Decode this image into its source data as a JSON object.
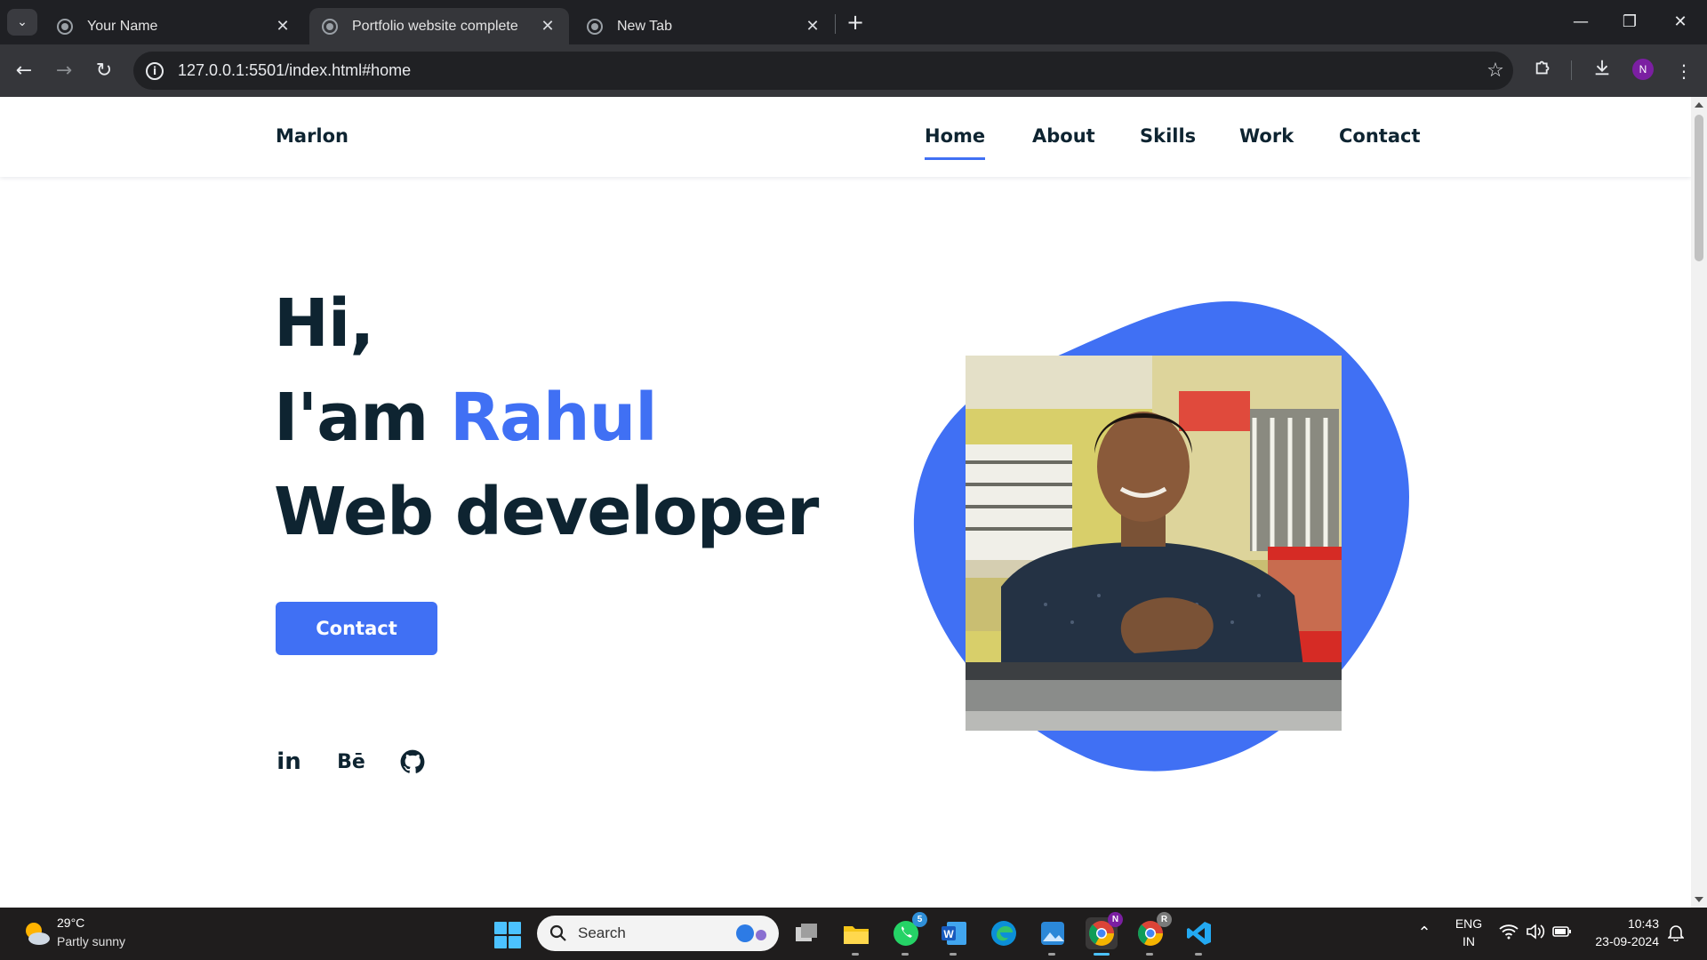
{
  "browser": {
    "tabs": [
      {
        "title": "Your Name",
        "active": false
      },
      {
        "title": "Portfolio website complete",
        "active": true
      },
      {
        "title": "New Tab",
        "active": false
      }
    ],
    "url": "127.0.0.1:5501/index.html#home",
    "profile_initial": "N",
    "icons": {
      "tab_search": "chevron-down-icon",
      "back": "arrow-left-icon",
      "forward": "arrow-right-icon",
      "reload": "reload-icon",
      "site_info": "info-icon",
      "bookmark": "star-icon",
      "extensions": "puzzle-icon",
      "downloads": "download-icon",
      "menu": "kebab-menu-icon",
      "minimize": "minimize-icon",
      "restore": "restore-icon",
      "close": "close-icon"
    }
  },
  "site": {
    "brand": "Marlon",
    "nav": [
      {
        "label": "Home",
        "active": true
      },
      {
        "label": "About",
        "active": false
      },
      {
        "label": "Skills",
        "active": false
      },
      {
        "label": "Work",
        "active": false
      },
      {
        "label": "Contact",
        "active": false
      }
    ],
    "hero": {
      "line1": "Hi,",
      "line2_prefix": "I'am ",
      "line2_name": "Rahul",
      "line3": "Web developer"
    },
    "cta_label": "Contact",
    "social": {
      "linkedin_glyph": "in",
      "behance_glyph": "Bē"
    },
    "colors": {
      "accent": "#4070f4",
      "text": "#0e2431"
    }
  },
  "taskbar": {
    "weather_temp": "29°C",
    "weather_condition": "Partly sunny",
    "search_placeholder": "Search",
    "whatsapp_badge": "5",
    "chrome_profile_badge_1": "N",
    "chrome_profile_badge_2": "R",
    "lang_line1": "ENG",
    "lang_line2": "IN",
    "time": "10:43",
    "date": "23-09-2024"
  }
}
